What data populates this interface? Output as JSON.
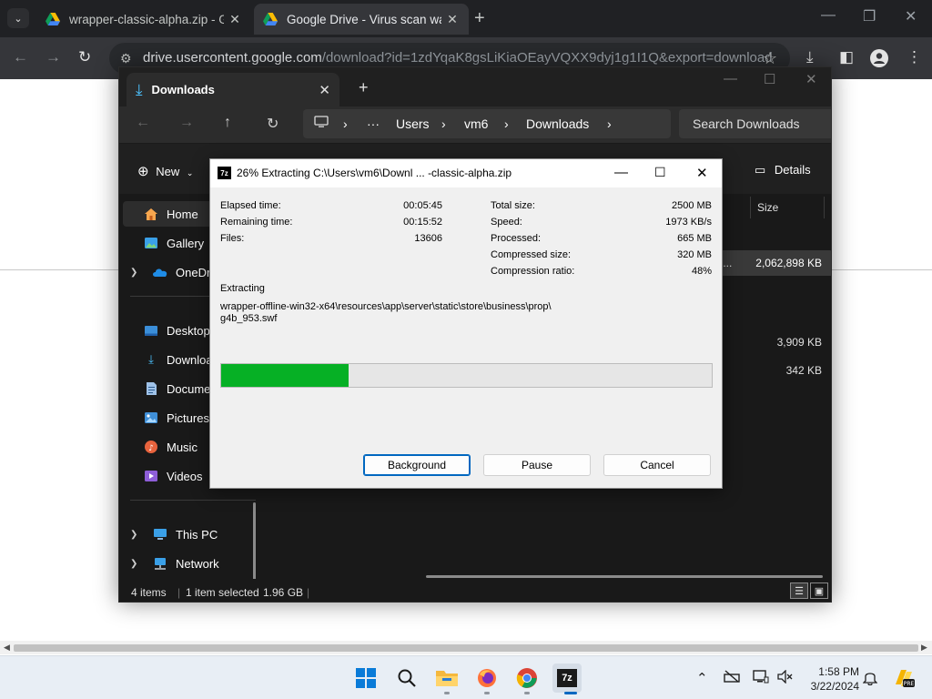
{
  "chrome": {
    "tabs": [
      {
        "title": "wrapper-classic-alpha.zip - Google Drive"
      },
      {
        "title": "Google Drive - Virus scan warning"
      }
    ],
    "url_host": "drive.usercontent.google.com",
    "url_path": "/download?id=1zdYqaK8gsLiKiaOEayVQXX9dyj1g1I1Q&export=download"
  },
  "explorer": {
    "tab_title": "Downloads",
    "breadcrumb": [
      "Users",
      "vm6",
      "Downloads"
    ],
    "breadcrumb_more": "···",
    "search_placeholder": "Search Downloads",
    "new_label": "New",
    "details_label": "Details",
    "sidebar": [
      {
        "label": "Home",
        "icon": "home-icon"
      },
      {
        "label": "Gallery",
        "icon": "gallery-icon"
      },
      {
        "label": "OneDrive",
        "icon": "onedrive-icon"
      },
      {
        "label": "Desktop",
        "icon": "desktop-icon"
      },
      {
        "label": "Downloads",
        "icon": "downloads-icon"
      },
      {
        "label": "Documents",
        "icon": "documents-icon"
      },
      {
        "label": "Pictures",
        "icon": "pictures-icon"
      },
      {
        "label": "Music",
        "icon": "music-icon"
      },
      {
        "label": "Videos",
        "icon": "videos-icon"
      },
      {
        "label": "This PC",
        "icon": "this-pc-icon"
      },
      {
        "label": "Network",
        "icon": "network-icon"
      }
    ],
    "size_column": "Size",
    "files": [
      {
        "name_fragment": "pp...",
        "size": "2,062,898 KB"
      },
      {
        "size": "3,909 KB"
      },
      {
        "size": "342 KB"
      }
    ],
    "status": {
      "items": "4 items",
      "selected": "1 item selected",
      "selected_size": "1.96 GB"
    }
  },
  "zip": {
    "title": "26% Extracting C:\\Users\\vm6\\Downl ... -classic-alpha.zip",
    "progress_percent": 26,
    "left_stats": [
      {
        "label": "Elapsed time:",
        "value": "00:05:45"
      },
      {
        "label": "Remaining time:",
        "value": "00:15:52"
      },
      {
        "label": "Files:",
        "value": "13606"
      }
    ],
    "right_stats": [
      {
        "label": "Total size:",
        "value": "2500 MB"
      },
      {
        "label": "Speed:",
        "value": "1973 KB/s"
      },
      {
        "label": "Processed:",
        "value": "665 MB"
      },
      {
        "label": "Compressed size:",
        "value": "320 MB"
      },
      {
        "label": "Compression ratio:",
        "value": "48%"
      }
    ],
    "action": "Extracting",
    "current_path_1": "wrapper-offline-win32-x64\\resources\\app\\server\\static\\store\\business\\prop\\",
    "current_path_2": "g4b_953.swf",
    "buttons": {
      "background": "Background",
      "pause": "Pause",
      "cancel": "Cancel"
    },
    "logo": "7z"
  },
  "taskbar": {
    "time": "1:58 PM",
    "date": "3/22/2024",
    "apps": [
      "start-icon",
      "search-icon",
      "file-explorer-icon",
      "firefox-icon",
      "chrome-icon",
      "7zip-icon"
    ],
    "zip_label": "7z"
  }
}
